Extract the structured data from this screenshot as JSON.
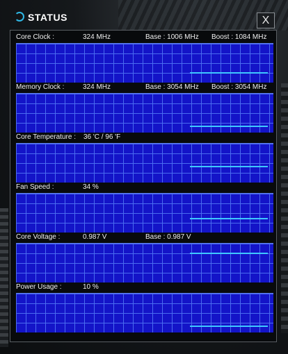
{
  "window": {
    "title": "STATUS",
    "close_label": "X"
  },
  "sections": [
    {
      "label": "Core Clock :",
      "value": "324 MHz",
      "base": "Base : 1006 MHz",
      "boost": "Boost : 1084 MHz",
      "level": 0.2
    },
    {
      "label": "Memory Clock :",
      "value": "324 MHz",
      "base": "Base : 3054 MHz",
      "boost": "Boost : 3054 MHz",
      "level": 0.1
    },
    {
      "label": "Core Temperature :",
      "value": "36 'C / 96 'F",
      "base": "",
      "boost": "",
      "level": 0.4
    },
    {
      "label": "Fan Speed :",
      "value": "34 %",
      "base": "",
      "boost": "",
      "level": 0.34
    },
    {
      "label": "Core Voltage :",
      "value": "0.987 V",
      "base": "Base : 0.987 V",
      "boost": "",
      "level": 0.8
    },
    {
      "label": "Power Usage :",
      "value": "10 %",
      "base": "",
      "boost": "",
      "level": 0.1
    }
  ],
  "colors": {
    "graph_bg": "#1414c8",
    "grid": "#4a6cf0",
    "line": "#3fc8ff"
  }
}
